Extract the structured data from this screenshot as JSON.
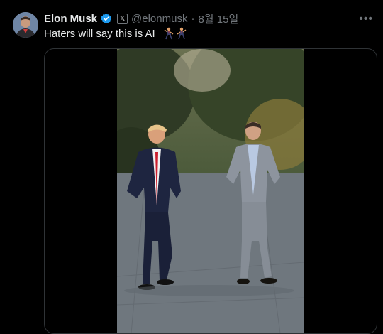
{
  "tweet": {
    "author_name": "Elon Musk",
    "handle": "@elonmusk",
    "separator": "·",
    "date": "8월 15일",
    "text": "Haters will say this is AI",
    "verified_icon": "verified-badge-icon",
    "affiliation_icon": "x-logo-icon",
    "more_label": "•••"
  },
  "colors": {
    "background": "#000000",
    "text_primary": "#e7e9ea",
    "text_secondary": "#71767b",
    "verified": "#1d9bf0",
    "border": "#2f3336"
  },
  "media": {
    "type": "video"
  }
}
